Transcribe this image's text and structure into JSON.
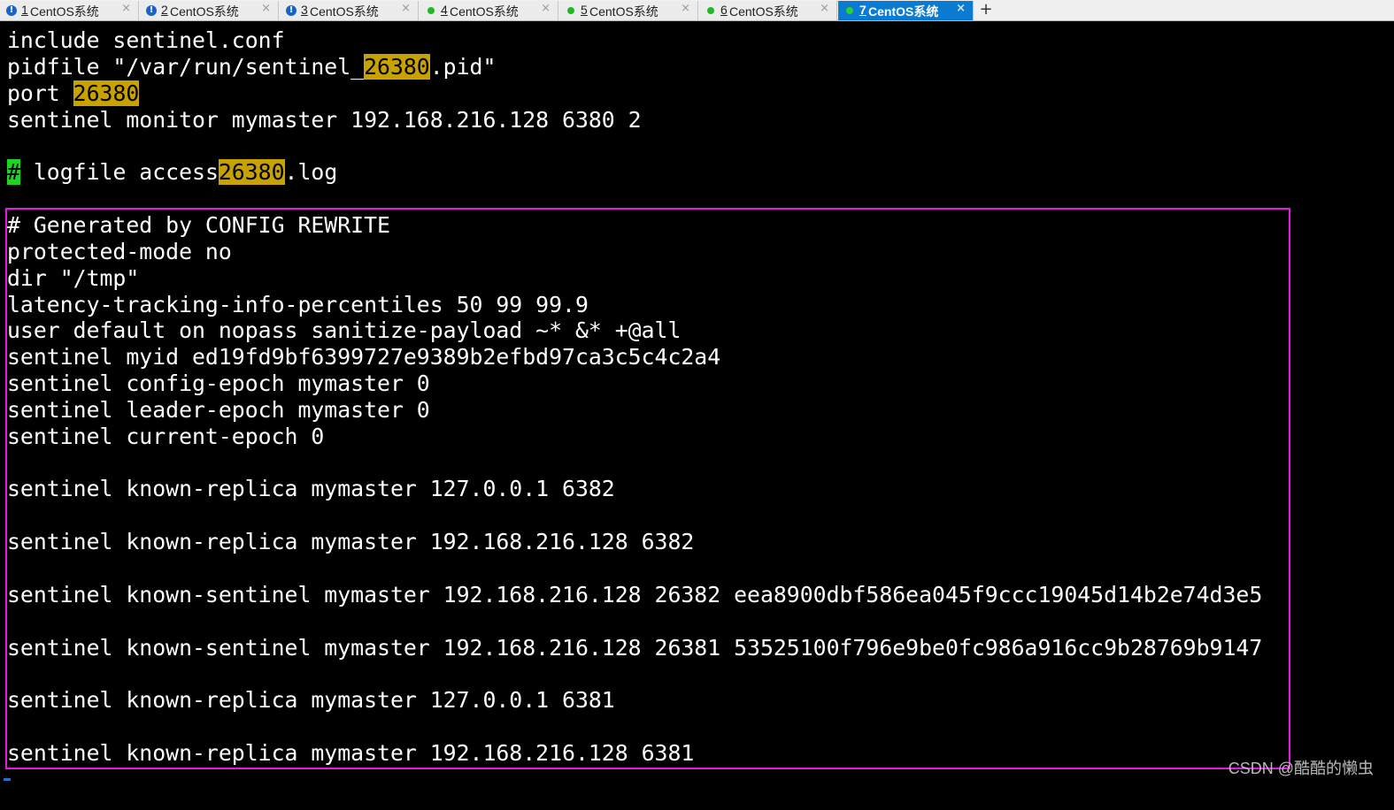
{
  "tabs": [
    {
      "num": "1",
      "title": "CentOS系统",
      "state": "alert",
      "active": false
    },
    {
      "num": "2",
      "title": "CentOS系统",
      "state": "alert",
      "active": false
    },
    {
      "num": "3",
      "title": "CentOS系统",
      "state": "alert",
      "active": false
    },
    {
      "num": "4",
      "title": "CentOS系统",
      "state": "ok",
      "active": false
    },
    {
      "num": "5",
      "title": "CentOS系统",
      "state": "ok",
      "active": false
    },
    {
      "num": "6",
      "title": "CentOS系统",
      "state": "ok",
      "active": false
    },
    {
      "num": "7",
      "title": "CentOS系统",
      "state": "ok",
      "active": true
    }
  ],
  "tab_icons": {
    "close": "close-icon",
    "new_tab": "plus-icon",
    "alert": "alert-icon",
    "ok": "status-dot-icon"
  },
  "new_tab_label": "+",
  "colors": {
    "highlight": "#c8a200",
    "cursor": "#1fd41f",
    "box": "#e21ae2",
    "active_tab": "#0a7bd1"
  },
  "terminal": {
    "lines": [
      {
        "segments": [
          {
            "t": "include sentinel.conf"
          }
        ]
      },
      {
        "segments": [
          {
            "t": "pidfile \"/var/run/sentinel_"
          },
          {
            "t": "26380",
            "hl": "match"
          },
          {
            "t": ".pid\""
          }
        ]
      },
      {
        "segments": [
          {
            "t": "port "
          },
          {
            "t": "26380",
            "hl": "match"
          }
        ]
      },
      {
        "segments": [
          {
            "t": "sentinel monitor mymaster 192.168.216.128 6380 2"
          }
        ]
      },
      {
        "segments": []
      },
      {
        "segments": [
          {
            "t": "#",
            "hl": "cursor"
          },
          {
            "t": " logfile access"
          },
          {
            "t": "26380",
            "hl": "match"
          },
          {
            "t": ".log"
          }
        ]
      },
      {
        "segments": []
      },
      {
        "segments": [
          {
            "t": "# Generated by CONFIG REWRITE"
          }
        ]
      },
      {
        "segments": [
          {
            "t": "protected-mode no"
          }
        ]
      },
      {
        "segments": [
          {
            "t": "dir \"/tmp\""
          }
        ]
      },
      {
        "segments": [
          {
            "t": "latency-tracking-info-percentiles 50 99 99.9"
          }
        ]
      },
      {
        "segments": [
          {
            "t": "user default on nopass sanitize-payload ~* &* +@all"
          }
        ]
      },
      {
        "segments": [
          {
            "t": "sentinel myid ed19fd9bf6399727e9389b2efbd97ca3c5c4c2a4"
          }
        ]
      },
      {
        "segments": [
          {
            "t": "sentinel config-epoch mymaster 0"
          }
        ]
      },
      {
        "segments": [
          {
            "t": "sentinel leader-epoch mymaster 0"
          }
        ]
      },
      {
        "segments": [
          {
            "t": "sentinel current-epoch 0"
          }
        ]
      },
      {
        "segments": []
      },
      {
        "segments": [
          {
            "t": "sentinel known-replica mymaster 127.0.0.1 6382"
          }
        ]
      },
      {
        "segments": []
      },
      {
        "segments": [
          {
            "t": "sentinel known-replica mymaster 192.168.216.128 6382"
          }
        ]
      },
      {
        "segments": []
      },
      {
        "segments": [
          {
            "t": "sentinel known-sentinel mymaster 192.168.216.128 26382 eea8900dbf586ea045f9ccc19045d14b2e74d3e5"
          }
        ]
      },
      {
        "segments": []
      },
      {
        "segments": [
          {
            "t": "sentinel known-sentinel mymaster 192.168.216.128 26381 53525100f796e9be0fc986a916cc9b28769b9147"
          }
        ]
      },
      {
        "segments": []
      },
      {
        "segments": [
          {
            "t": "sentinel known-replica mymaster 127.0.0.1 6381"
          }
        ]
      },
      {
        "segments": []
      },
      {
        "segments": [
          {
            "t": "sentinel known-replica mymaster 192.168.216.128 6381"
          }
        ]
      }
    ]
  },
  "watermark": "CSDN @酷酷的懒虫"
}
